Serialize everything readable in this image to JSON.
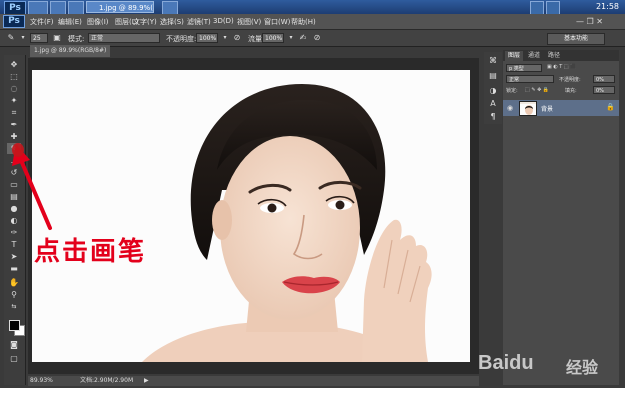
{
  "taskbar": {
    "app_badge": "Ps",
    "task_title": "1.jpg @ 89.9%(R...",
    "clock": "21:58"
  },
  "menubar": {
    "items": [
      "文件(F)",
      "编辑(E)",
      "图像(I)",
      "图层(L)",
      "文字(Y)",
      "选择(S)",
      "滤镜(T)",
      "3D(D)",
      "视图(V)",
      "窗口(W)",
      "帮助(H)"
    ],
    "window_controls": "— ❐ ✕"
  },
  "options": {
    "brush_size": "25",
    "mode_label": "模式:",
    "mode_value": "正常",
    "opacity_label": "不透明度:",
    "opacity_value": "100%",
    "flow_label": "流量:",
    "flow_value": "100%",
    "workspace": "基本功能"
  },
  "document": {
    "tab_title": "1.jpg @ 89.9%(RGB/8#)",
    "zoom": "89.93%",
    "doc_info": "文档:2.90M/2.90M"
  },
  "layers_panel": {
    "tabs": [
      "图层",
      "通道",
      "路径"
    ],
    "kind_label": "p 类型",
    "blend_mode": "正常",
    "opacity_label": "不透明度:",
    "opacity_value": "0%",
    "lock_label": "锁定:",
    "fill_label": "填充:",
    "fill_value": "0%",
    "layer_name": "背景"
  },
  "annotation": {
    "text": "点击画笔"
  },
  "watermark": {
    "text": "Baidu",
    "text_cn": "经验"
  },
  "colors": {
    "annotation": "#e3001b",
    "ps_bg": "#3a3a3a",
    "layer_selected": "#5d6f8a"
  }
}
